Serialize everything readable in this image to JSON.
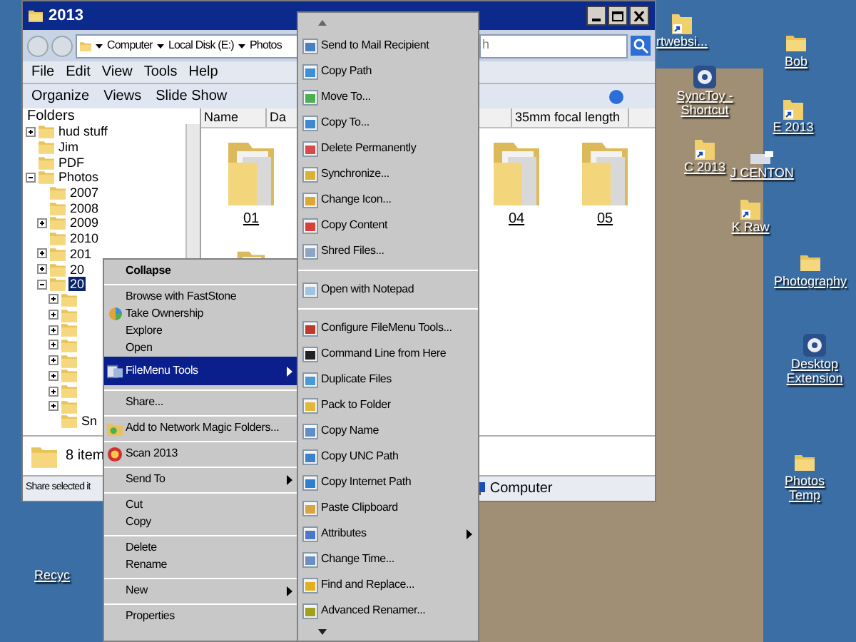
{
  "desktop": {
    "icons": [
      {
        "label": "rtwebsi...",
        "kind": "shortcut"
      },
      {
        "label": "Bob",
        "kind": "folder"
      },
      {
        "label": "SyncToy - Shortcut",
        "kind": "app"
      },
      {
        "label": "E 2013",
        "kind": "shortcut"
      },
      {
        "label": "C 2013",
        "kind": "shortcut"
      },
      {
        "label": "J CENTON",
        "kind": "drive"
      },
      {
        "label": "K Raw",
        "kind": "shortcut"
      },
      {
        "label": "Photography",
        "kind": "folder"
      },
      {
        "label": "Desktop Extension",
        "kind": "app"
      },
      {
        "label": "Photos Temp",
        "kind": "folder"
      },
      {
        "label": "Recyc",
        "kind": "hidden"
      }
    ]
  },
  "window": {
    "title": "2013"
  },
  "address": {
    "crumbs": [
      "Computer",
      "Local Disk (E:)",
      "Photos"
    ]
  },
  "search": {
    "placeholder": "h"
  },
  "menu": [
    "File",
    "Edit",
    "View",
    "Tools",
    "Help"
  ],
  "toolbar": [
    "Organize",
    "Views",
    "Slide Show"
  ],
  "folders_pane": {
    "title": "Folders",
    "tree": [
      {
        "label": "hud stuff",
        "expanded": false,
        "selected": false
      },
      {
        "label": "Jim",
        "selected": false
      },
      {
        "label": "PDF",
        "selected": false
      },
      {
        "label": "Photos",
        "expanded": true,
        "selected": false,
        "children": [
          {
            "label": "2007",
            "selected": false
          },
          {
            "label": "2008",
            "selected": false
          },
          {
            "label": "2009",
            "expanded": false,
            "selected": false
          },
          {
            "label": "2010",
            "selected": false
          },
          {
            "label": "201",
            "expanded": false,
            "selected": false
          },
          {
            "label": "20",
            "expanded": false,
            "selected": false
          },
          {
            "label": "20",
            "expanded": true,
            "selected": true,
            "children": [
              {
                "expanded": false
              },
              {
                "expanded": false
              },
              {
                "expanded": false
              },
              {
                "expanded": false
              },
              {
                "expanded": false
              },
              {
                "expanded": false
              },
              {
                "expanded": false
              },
              {
                "expanded": false
              },
              {
                "label": "Sn",
                "selected": false
              }
            ]
          }
        ]
      }
    ]
  },
  "columns": [
    "Name",
    "Da",
    "35mm focal length"
  ],
  "items": [
    {
      "label": "01"
    },
    {
      "label": "04"
    },
    {
      "label": "05"
    }
  ],
  "details": {
    "count": "8 item"
  },
  "status_bar": {
    "left": "Share selected it",
    "right": "Computer"
  },
  "context_menu": [
    {
      "kind": "item",
      "label": "Collapse",
      "default": true,
      "selected": false
    },
    {
      "kind": "separator"
    },
    {
      "kind": "item",
      "label": "Browse with FastStone",
      "selected": false
    },
    {
      "kind": "item",
      "label": "Take Ownership",
      "icon": true,
      "selected": false
    },
    {
      "kind": "item",
      "label": "Explore",
      "selected": false
    },
    {
      "kind": "item",
      "label": "Open",
      "selected": false
    },
    {
      "kind": "item",
      "label": "FileMenu Tools",
      "icon": true,
      "submenu": true,
      "selected": true
    },
    {
      "kind": "separator"
    },
    {
      "kind": "item",
      "label": "Share...",
      "selected": false
    },
    {
      "kind": "separator"
    },
    {
      "kind": "item",
      "label": "Add to Network Magic Folders...",
      "icon": true,
      "selected": false
    },
    {
      "kind": "separator"
    },
    {
      "kind": "item",
      "label": "Scan 2013",
      "icon": true,
      "selected": false
    },
    {
      "kind": "separator"
    },
    {
      "kind": "item",
      "label": "Send To",
      "submenu": true,
      "selected": false
    },
    {
      "kind": "separator"
    },
    {
      "kind": "item",
      "label": "Cut",
      "selected": false
    },
    {
      "kind": "item",
      "label": "Copy",
      "selected": false
    },
    {
      "kind": "separator"
    },
    {
      "kind": "item",
      "label": "Delete",
      "selected": false
    },
    {
      "kind": "item",
      "label": "Rename",
      "selected": false
    },
    {
      "kind": "separator"
    },
    {
      "kind": "item",
      "label": "New",
      "submenu": true,
      "selected": false
    },
    {
      "kind": "separator"
    },
    {
      "kind": "item",
      "label": "Properties",
      "selected": false
    }
  ],
  "submenu": [
    {
      "kind": "item",
      "label": "Send to Mail Recipient"
    },
    {
      "kind": "item",
      "label": "Copy Path"
    },
    {
      "kind": "item",
      "label": "Move To..."
    },
    {
      "kind": "item",
      "label": "Copy To..."
    },
    {
      "kind": "item",
      "label": "Delete Permanently"
    },
    {
      "kind": "item",
      "label": "Synchronize..."
    },
    {
      "kind": "item",
      "label": "Change Icon..."
    },
    {
      "kind": "item",
      "label": "Copy Content"
    },
    {
      "kind": "item",
      "label": "Shred Files..."
    },
    {
      "kind": "separator"
    },
    {
      "kind": "item",
      "label": "Open with Notepad"
    },
    {
      "kind": "separator"
    },
    {
      "kind": "item",
      "label": "Configure FileMenu Tools..."
    },
    {
      "kind": "item",
      "label": "Command Line from Here"
    },
    {
      "kind": "item",
      "label": "Duplicate Files"
    },
    {
      "kind": "item",
      "label": "Pack to Folder"
    },
    {
      "kind": "item",
      "label": "Copy Name"
    },
    {
      "kind": "item",
      "label": "Copy UNC Path"
    },
    {
      "kind": "item",
      "label": "Copy Internet Path"
    },
    {
      "kind": "item",
      "label": "Paste Clipboard"
    },
    {
      "kind": "item",
      "label": "Attributes",
      "submenu": true
    },
    {
      "kind": "item",
      "label": "Change Time..."
    },
    {
      "kind": "item",
      "label": "Find and Replace..."
    },
    {
      "kind": "item",
      "label": "Advanced Renamer..."
    }
  ]
}
